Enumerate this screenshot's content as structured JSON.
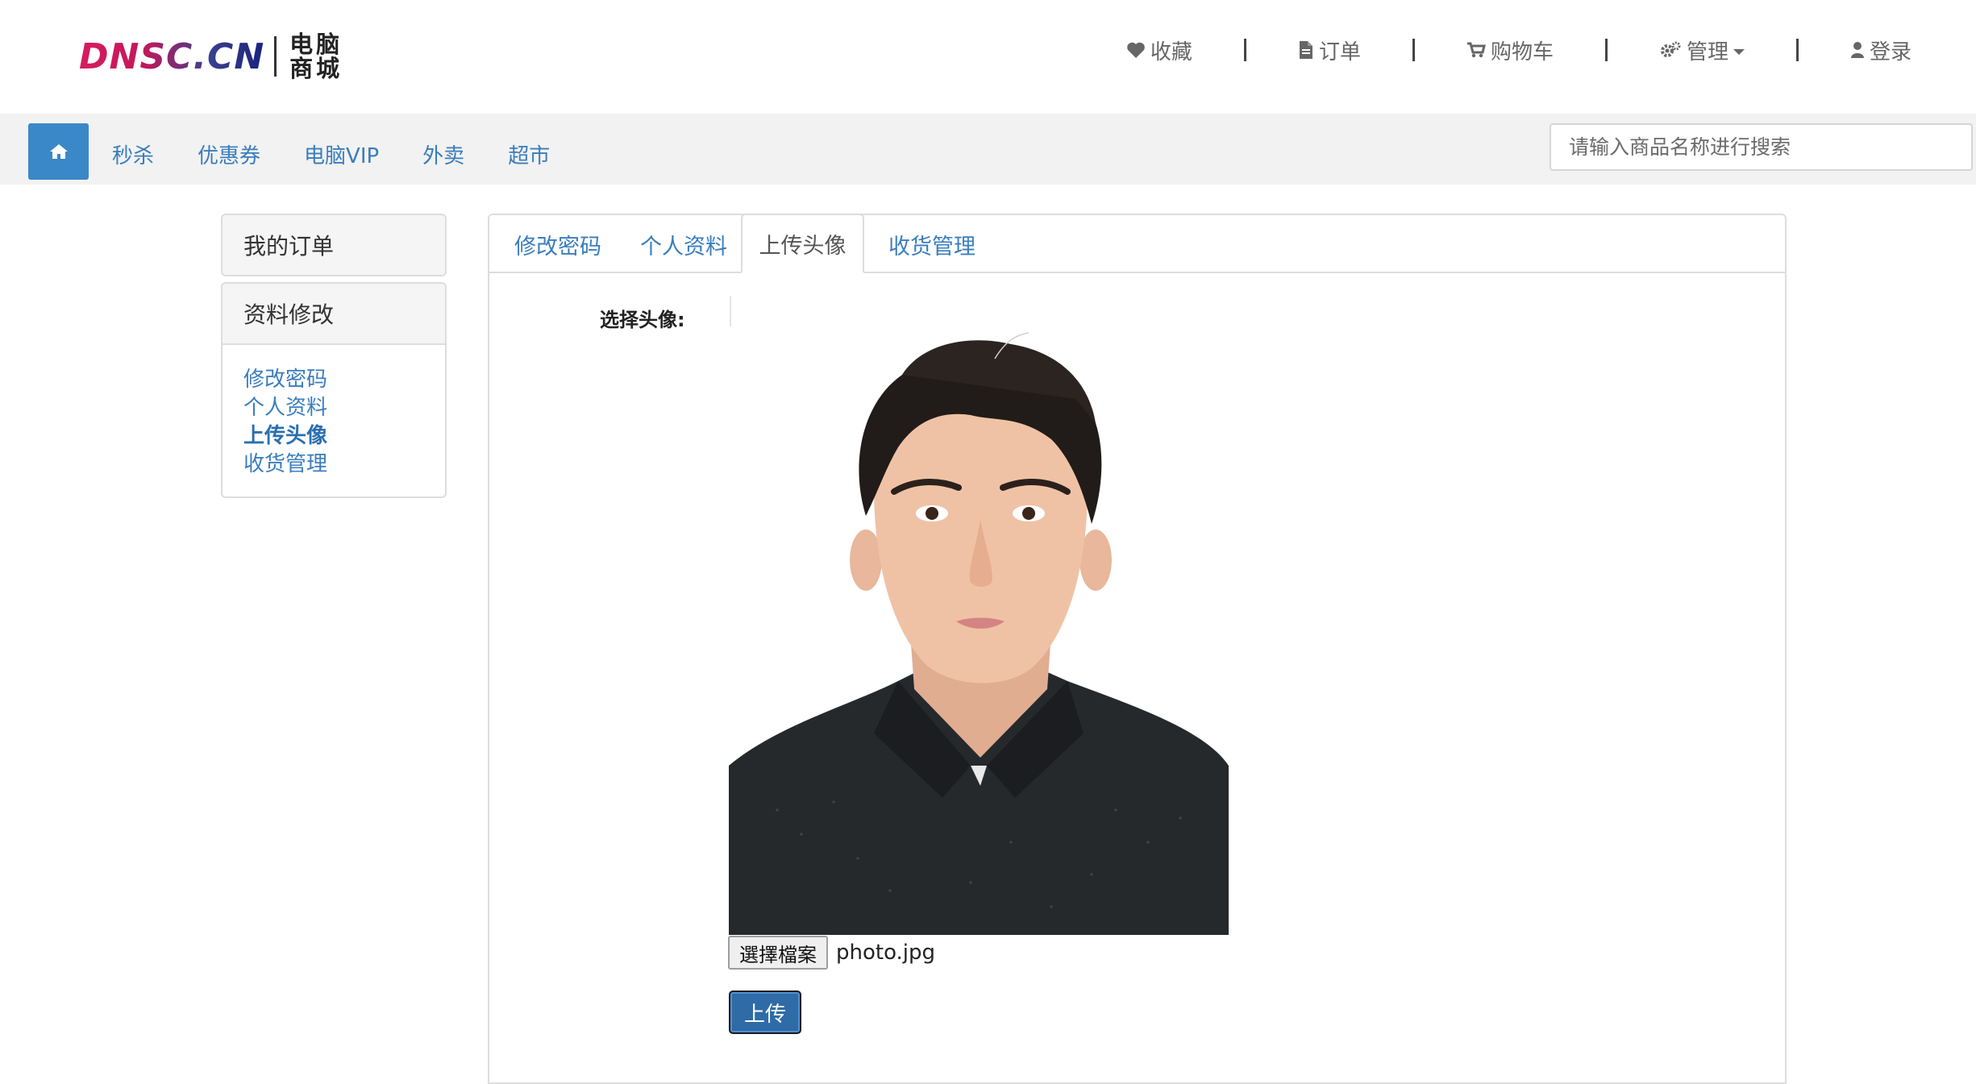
{
  "header": {
    "logo_en": "DNSC.CN",
    "logo_cn_line1": "电脑",
    "logo_cn_line2": "商城",
    "nav": [
      {
        "label": "收藏",
        "icon": "heart-icon"
      },
      {
        "label": "订单",
        "icon": "document-icon"
      },
      {
        "label": "购物车",
        "icon": "cart-icon"
      },
      {
        "label": "管理",
        "icon": "gears-icon",
        "dropdown": true
      },
      {
        "label": "登录",
        "icon": "user-icon"
      }
    ]
  },
  "navbar": {
    "home_icon": "home-icon",
    "links": [
      "秒杀",
      "优惠券",
      "电脑VIP",
      "外卖",
      "超市"
    ],
    "search_placeholder": "请输入商品名称进行搜索"
  },
  "sidebar": {
    "orders_title": "我的订单",
    "profile_title": "资料修改",
    "links": [
      "修改密码",
      "个人资料",
      "上传头像",
      "收货管理"
    ],
    "active_index": 2
  },
  "content": {
    "tabs": [
      "修改密码",
      "个人资料",
      "上传头像",
      "收货管理"
    ],
    "active_tab": 2,
    "form_label": "选择头像:",
    "file_button": "選擇檔案",
    "file_name": "photo.jpg",
    "upload_button": "上传"
  },
  "colors": {
    "link": "#3a7dbd",
    "primary": "#3a88c8",
    "upload": "#2e6ba7"
  }
}
